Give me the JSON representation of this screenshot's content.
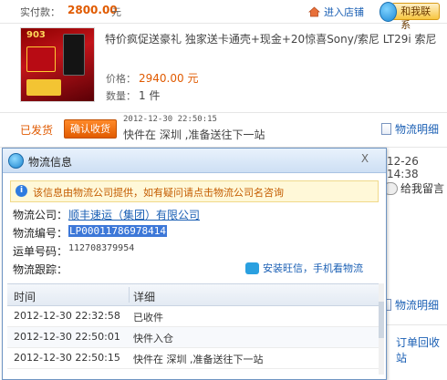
{
  "order": {
    "pay_label": "实付款：",
    "pay_amount": "2800.00",
    "pay_unit": "元",
    "shop_link": "进入店铺",
    "contact_label": "和我联系",
    "title": "特价疯促送豪礼 独家送卡通壳+现金+20惊喜Sony/索尼 LT29i 索尼",
    "price_label": "价格：",
    "price_value": "2940.00 元",
    "qty_label": "数量：",
    "qty_value": "1 件",
    "status": "已发货",
    "confirm_button": "确认收货",
    "track_time": "2012-12-30 22:50:15",
    "track_msg": "快件在 深圳 ,准备送往下一站",
    "detail_link": "物流明细",
    "thumb_text": "903"
  },
  "background": {
    "date": "12-26 14:38",
    "message": "给我留言",
    "detail_link": "物流明细",
    "return_link": "订单回收站"
  },
  "popup": {
    "title": "物流信息",
    "close": "X",
    "notice": "该信息由物流公司提供，如有疑问请点击物流公司名咨询",
    "company_label": "物流公司：",
    "company_value": "顺丰速运（集团）有限公司",
    "tracking_label": "物流编号：",
    "tracking_value": "LP00011786978414",
    "waybill_label": "运单号码：",
    "waybill_value": "112708379954",
    "follow_label": "物流跟踪：",
    "wangwang_link": "安装旺信，手机看物流",
    "table": {
      "headers": [
        "时间",
        "详细"
      ],
      "rows": [
        {
          "time": "2012-12-30 22:32:58",
          "detail": "已收件"
        },
        {
          "time": "2012-12-30 22:50:01",
          "detail": "快件入仓"
        },
        {
          "time": "2012-12-30 22:50:15",
          "detail": "快件在 深圳 ,准备送往下一站"
        }
      ]
    }
  },
  "colors": {
    "accent_orange": "#e05a00",
    "link_blue": "#1a5fb4",
    "notice_bg": "#fff8d8",
    "selection_blue": "#3d78d8"
  }
}
